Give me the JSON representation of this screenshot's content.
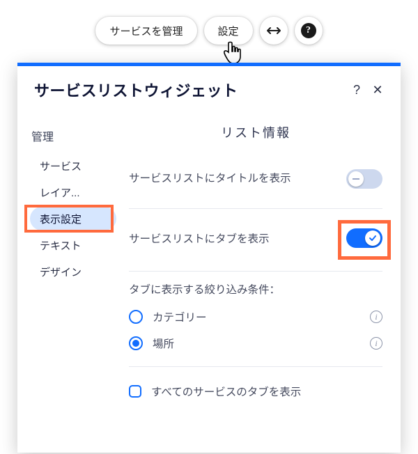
{
  "topbar": {
    "manage_label": "サービスを管理",
    "settings_label": "設定",
    "stretch_icon": "↔",
    "help_icon": "?"
  },
  "panel": {
    "title": "サービスリストウィジェット",
    "help": "?",
    "close": "✕"
  },
  "sidebar": {
    "heading": "管理",
    "items": [
      {
        "label": "サービス",
        "active": false
      },
      {
        "label": "レイア...",
        "active": false
      },
      {
        "label": "表示設定",
        "active": true
      },
      {
        "label": "テキスト",
        "active": false
      },
      {
        "label": "デザイン",
        "active": false
      }
    ]
  },
  "content": {
    "heading": "リスト情報",
    "show_title_label": "サービスリストにタイトルを表示",
    "show_title_on": false,
    "show_tabs_label": "サービスリストにタブを表示",
    "show_tabs_on": true,
    "filter_heading": "タブに表示する絞り込み条件：",
    "radio_category": "カテゴリー",
    "radio_location": "場所",
    "radio_selected": "location",
    "show_all_label": "すべてのサービスのタブを表示",
    "show_all_checked": false
  }
}
